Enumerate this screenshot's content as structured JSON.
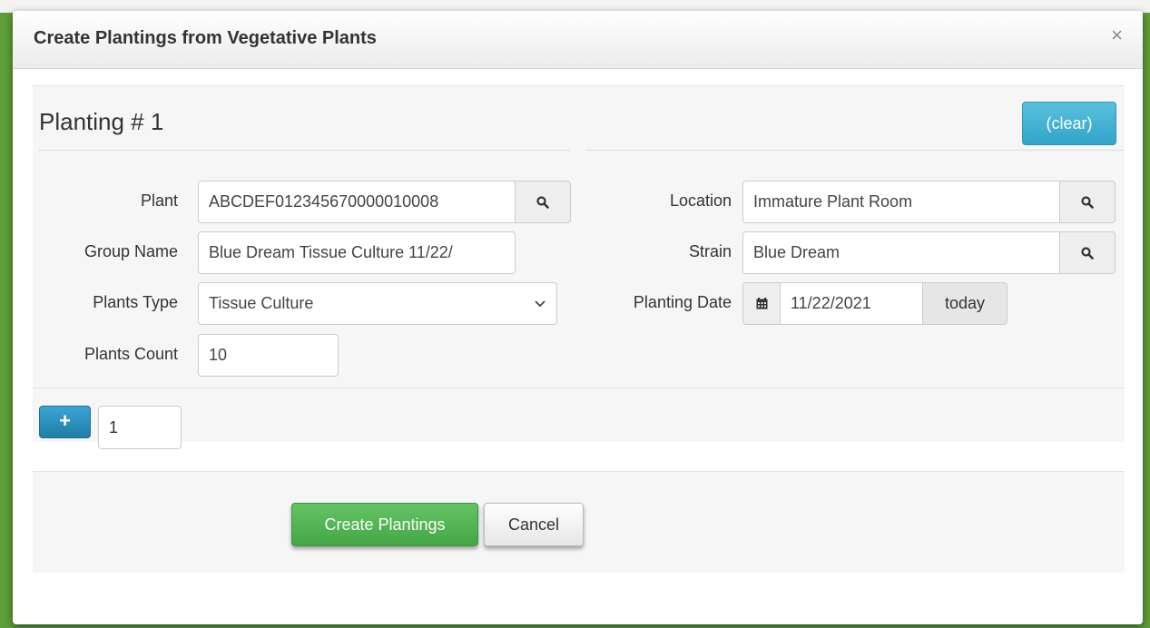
{
  "dialog": {
    "title": "Create Plantings from Vegetative Plants",
    "close_label": "×"
  },
  "planting": {
    "heading": "Planting # 1",
    "clear_label": "(clear)"
  },
  "form": {
    "plant": {
      "label": "Plant",
      "value": "ABCDEF012345670000010008"
    },
    "group_name": {
      "label": "Group Name",
      "value": "Blue Dream Tissue Culture 11/22/"
    },
    "plants_type": {
      "label": "Plants Type",
      "value": "Tissue Culture"
    },
    "plants_count": {
      "label": "Plants Count",
      "value": "10"
    },
    "location": {
      "label": "Location",
      "value": "Immature Plant Room"
    },
    "strain": {
      "label": "Strain",
      "value": "Blue Dream"
    },
    "planting_date": {
      "label": "Planting Date",
      "value": "11/22/2021",
      "today_label": "today"
    }
  },
  "add_row": {
    "plus_label": "+",
    "count_value": "1"
  },
  "footer": {
    "create_label": "Create Plantings",
    "cancel_label": "Cancel"
  },
  "icons": {
    "search": "search-icon",
    "calendar": "calendar-icon",
    "chevron": "chevron-down-icon"
  },
  "colors": {
    "backdrop": "#5f9e3a",
    "info": "#5bc0de",
    "primary": "#2a8fbd",
    "success": "#5cb85c"
  }
}
